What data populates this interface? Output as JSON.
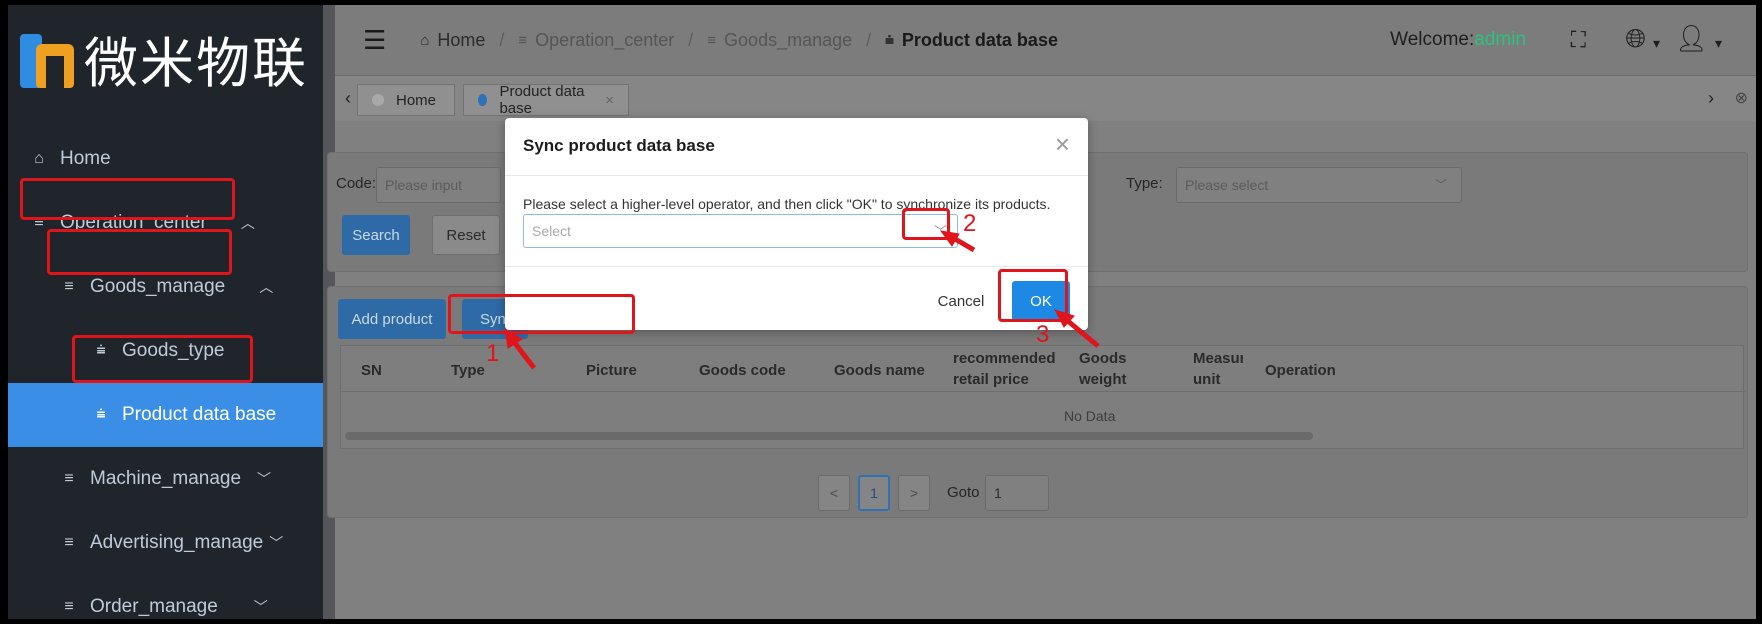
{
  "brand": {
    "logo_text": "微米物联"
  },
  "sidebar": {
    "items": [
      {
        "label": "Home",
        "icon": "home-icon"
      },
      {
        "label": "Operation_center",
        "icon": "menu-icon"
      },
      {
        "label": "Goods_manage",
        "icon": "menu-icon"
      },
      {
        "label": "Goods_type",
        "icon": "filter-icon"
      },
      {
        "label": "Product data base",
        "icon": "filter-icon"
      },
      {
        "label": "Machine_manage",
        "icon": "menu-icon"
      },
      {
        "label": "Advertising_manage",
        "icon": "menu-icon"
      },
      {
        "label": "Order_manage",
        "icon": "menu-icon"
      }
    ]
  },
  "header": {
    "breadcrumbs": [
      "Home",
      "Operation_center",
      "Goods_manage",
      "Product data base"
    ],
    "welcome_prefix": "Welcome:",
    "username": "admin"
  },
  "tabs": [
    {
      "label": "Home"
    },
    {
      "label": "Product data base"
    }
  ],
  "search_form": {
    "code_label": "Code:",
    "code_placeholder": "Please input",
    "type_label": "Type:",
    "type_placeholder": "Please select",
    "search_label": "Search",
    "reset_label": "Reset"
  },
  "toolbar": {
    "add_label": "Add product",
    "sync_label": "Sync"
  },
  "table": {
    "columns": [
      "SN",
      "Type",
      "Picture",
      "Goods code",
      "Goods name",
      "recommended retail price",
      "Goods weight",
      "Measure unit",
      "Operation"
    ],
    "empty_text": "No Data"
  },
  "pagination": {
    "prev": "<",
    "page": "1",
    "next": ">",
    "goto_label": "Goto",
    "goto_value": "1"
  },
  "dialog": {
    "title": "Sync product data base",
    "description": "Please select a higher-level operator, and then click \"OK\" to synchronize its products.",
    "select_placeholder": "Select",
    "cancel_label": "Cancel",
    "ok_label": "OK"
  },
  "annotations": {
    "step1": "1",
    "step2": "2",
    "step3": "3",
    "color": "#e0141b"
  },
  "colors": {
    "accent": "#1e88e5",
    "active_menu": "#3a8ee6",
    "sidebar_bg": "#1f252b",
    "welcome_user": "#27c57d"
  }
}
